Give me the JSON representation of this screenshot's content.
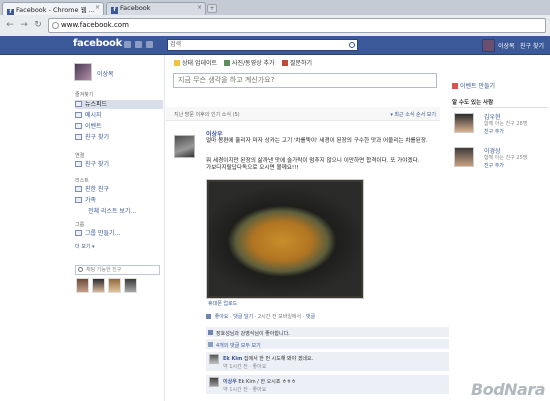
{
  "browser": {
    "tabs": [
      {
        "label": "Facebook - Chrome 웹 ..."
      },
      {
        "label": "Facebook"
      }
    ],
    "new_tab": "+",
    "url": "www.facebook.com"
  },
  "fb_bar": {
    "logo": "facebook",
    "search_text": "검색",
    "profile_link": "이상복",
    "find_friends_link": "친구 찾기"
  },
  "sidebar": {
    "profile_name": "이상복",
    "favorites_header": "즐겨찾기",
    "favorites": [
      {
        "label": "뉴스피드",
        "active": true
      },
      {
        "label": "메시지",
        "active": false
      },
      {
        "label": "이벤트",
        "active": false
      },
      {
        "label": "친구 찾기",
        "active": false
      }
    ],
    "connections_header": "연결",
    "connections": [
      {
        "label": "친구 찾기"
      }
    ],
    "lists_header": "리스트",
    "lists": [
      {
        "label": "친한 친구"
      },
      {
        "label": "가족"
      }
    ],
    "lists_more": "전체 리스트 보기...",
    "groups_header": "그룹",
    "groups": [
      {
        "label": "그룹 만들기..."
      }
    ],
    "more_link": "더 보기 ▾",
    "chat_search_placeholder": "채팅 가능한 친구"
  },
  "composer": {
    "tabs": [
      {
        "label": "상태 업데이트",
        "icon": "status-icon"
      },
      {
        "label": "사진/동영상 추가",
        "icon": "photo-icon"
      },
      {
        "label": "질문하기",
        "icon": "question-icon"
      }
    ],
    "placeholder": "지금 무슨 생각을 하고 계신가요?"
  },
  "feed_header": {
    "left": "지난 방문 이후의 인기 소식 (5)",
    "right": "▾ 최근 소식 순서 보기"
  },
  "post": {
    "author": "이상우",
    "text_line1": "얼마 봄편에 흘리자 마자 상카는 고기 '차를뚝이' 세경이 된장의 구수한 맛과 어울리는 차를된장.",
    "text_line2": "뭐 세경이지만 된장의 삶까낸 맛에 슬가락이 멈추지 않으니 이만하면 합격이다. 또 가야겠다.",
    "text_line3": "가보다지랄답다독으로 오시면 볼께요!!!",
    "photo_caption": "휴대폰 업로드",
    "actions": [
      "좋아요",
      "댓글 달기",
      "2시간 전 모바일에서",
      "댓글"
    ],
    "likes_text": "장호성님과 강영식님이 좋아합니다.",
    "view_comments": "4개의 댓글 모두 보기",
    "comments": [
      {
        "author": "Ek Kim",
        "text": "집에서 한 번 시도해 봐야 겠네요.",
        "meta": "약 1시간 전 · 좋아요"
      },
      {
        "author": "이상우",
        "text": "Ek Kim / 한 오시죠 ㅎㅎㅎ",
        "meta": "약 1시간 전 · 좋아요"
      }
    ]
  },
  "right_col": {
    "events": "이벤트 만들기",
    "pymk_header": "알 수도 있는 사람",
    "people": [
      {
        "name": "김우현",
        "sub": "함께 아는 친구 28명",
        "add": "친구 추가"
      },
      {
        "name": "이경상",
        "sub": "함께 아는 친구 25명",
        "add": "친구 추가"
      }
    ]
  },
  "watermark": "BodNara",
  "colors": {
    "facebook_blue": "#3b5998",
    "link": "#3b5998",
    "nav_active": "#d8dfea"
  }
}
